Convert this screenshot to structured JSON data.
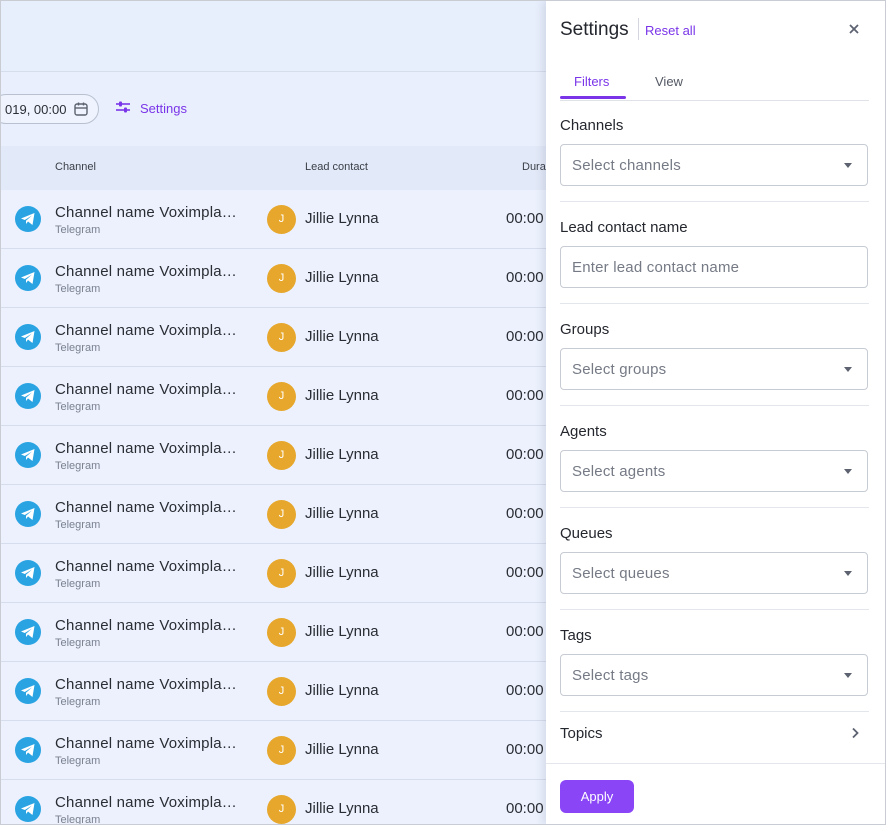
{
  "toolbar": {
    "date_value": "019, 00:00",
    "settings_label": "Settings"
  },
  "table": {
    "headers": {
      "channel": "Channel",
      "lead_contact": "Lead contact",
      "duration": "Dura"
    },
    "rows": [
      {
        "channel": "Channel name Voximpla…",
        "channel_type": "Telegram",
        "avatar": "J",
        "lead": "Jillie Lynna",
        "duration": "00:00"
      },
      {
        "channel": "Channel name Voximpla…",
        "channel_type": "Telegram",
        "avatar": "J",
        "lead": "Jillie Lynna",
        "duration": "00:00"
      },
      {
        "channel": "Channel name Voximpla…",
        "channel_type": "Telegram",
        "avatar": "J",
        "lead": "Jillie Lynna",
        "duration": "00:00"
      },
      {
        "channel": "Channel name Voximpla…",
        "channel_type": "Telegram",
        "avatar": "J",
        "lead": "Jillie Lynna",
        "duration": "00:00"
      },
      {
        "channel": "Channel name Voximpla…",
        "channel_type": "Telegram",
        "avatar": "J",
        "lead": "Jillie Lynna",
        "duration": "00:00"
      },
      {
        "channel": "Channel name Voximpla…",
        "channel_type": "Telegram",
        "avatar": "J",
        "lead": "Jillie Lynna",
        "duration": "00:00"
      },
      {
        "channel": "Channel name Voximpla…",
        "channel_type": "Telegram",
        "avatar": "J",
        "lead": "Jillie Lynna",
        "duration": "00:00"
      },
      {
        "channel": "Channel name Voximpla…",
        "channel_type": "Telegram",
        "avatar": "J",
        "lead": "Jillie Lynna",
        "duration": "00:00"
      },
      {
        "channel": "Channel name Voximpla…",
        "channel_type": "Telegram",
        "avatar": "J",
        "lead": "Jillie Lynna",
        "duration": "00:00"
      },
      {
        "channel": "Channel name Voximpla…",
        "channel_type": "Telegram",
        "avatar": "J",
        "lead": "Jillie Lynna",
        "duration": "00:00"
      },
      {
        "channel": "Channel name Voximpla…",
        "channel_type": "Telegram",
        "avatar": "J",
        "lead": "Jillie Lynna",
        "duration": "00:00"
      }
    ]
  },
  "panel": {
    "title": "Settings",
    "reset_label": "Reset all",
    "tabs": [
      {
        "label": "Filters",
        "active": true
      },
      {
        "label": "View",
        "active": false
      }
    ],
    "filters": [
      {
        "label": "Channels",
        "placeholder": "Select channels",
        "kind": "select"
      },
      {
        "label": "Lead contact name",
        "placeholder": "Enter lead contact name",
        "kind": "input"
      },
      {
        "label": "Groups",
        "placeholder": "Select groups",
        "kind": "select"
      },
      {
        "label": "Agents",
        "placeholder": "Select agents",
        "kind": "select"
      },
      {
        "label": "Queues",
        "placeholder": "Select queues",
        "kind": "select"
      },
      {
        "label": "Tags",
        "placeholder": "Select tags",
        "kind": "select"
      }
    ],
    "topics_label": "Topics",
    "apply_label": "Apply"
  },
  "colors": {
    "accent": "#7a35e9",
    "button": "#8a45f7",
    "telegram": "#2aa3e2",
    "avatar": "#e6a72c"
  },
  "icons": [
    "calendar-icon",
    "settings-sliders-icon",
    "telegram-icon",
    "close-icon",
    "chevron-right-icon",
    "dropdown-caret-icon"
  ]
}
